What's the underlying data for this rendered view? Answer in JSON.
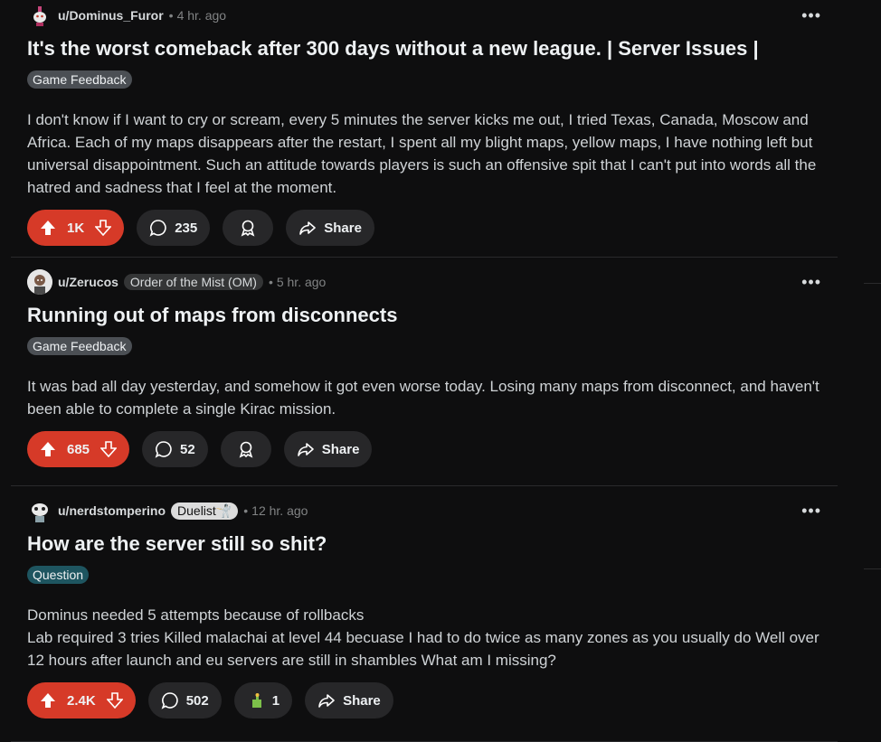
{
  "posts": [
    {
      "username": "u/Dominus_Furor",
      "user_flair": "",
      "time": "4 hr. ago",
      "title": "It's the worst comeback after 300 days without a new league. | Server Issues |",
      "flair": "Game Feedback",
      "body": "I don't know if I want to cry or scream, every 5 minutes the server kicks me out, I tried Texas, Canada, Moscow and Africa. Each of my maps disappears after the restart, I spent all my blight maps, yellow maps, I have nothing left but universal disappointment. Such an attitude towards players is such an offensive spit that I can't put into words all the hatred and sadness that I feel at the moment.",
      "votes": "1K",
      "comments": "235",
      "share": "Share"
    },
    {
      "username": "u/Zerucos",
      "user_flair": "Order of the Mist (OM)",
      "time": "5 hr. ago",
      "title": "Running out of maps from disconnects",
      "flair": "Game Feedback",
      "body": "It was bad all day yesterday, and somehow it got even worse today. Losing many maps from disconnect, and haven't been able to complete a single Kirac mission.",
      "votes": "685",
      "comments": "52",
      "share": "Share"
    },
    {
      "username": "u/nerdstomperino",
      "user_flair": "Duelist🤺",
      "time": "12 hr. ago",
      "title": "How are the server still so shit?",
      "flair": "Question",
      "body": "Dominus needed 5 attempts because of rollbacks\nLab required 3 tries Killed malachai at level 44 becuase I had to do twice as many zones as you usually do Well over 12 hours after launch and eu servers are still in shambles What am I missing?",
      "votes": "2.4K",
      "comments": "502",
      "award_count": "1",
      "share": "Share"
    }
  ],
  "colors": {
    "vote_active": "#d63a28",
    "pill": "#272729",
    "question_flair": "#1e5560"
  },
  "icons": [
    "reddit-snoo-avatar",
    "ellipsis-icon",
    "upvote-icon",
    "downvote-icon",
    "comment-icon",
    "award-icon",
    "share-icon"
  ]
}
